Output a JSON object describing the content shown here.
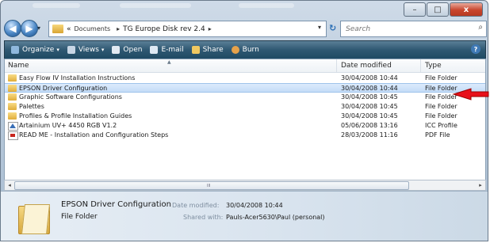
{
  "window": {
    "caption_buttons": {
      "minimize": "–",
      "maximize": "□",
      "close": "x"
    }
  },
  "address_bar": {
    "back_glyph": "◀",
    "forward_glyph": "▶",
    "overflow": "«",
    "crumbs": [
      "Documents",
      "TG Europe Disk rev 2.4"
    ],
    "separator": "▸",
    "dropdown_glyph": "▾",
    "refresh_glyph": "↻"
  },
  "search": {
    "placeholder": "Search",
    "icon": "search-icon"
  },
  "toolbar": {
    "organize": "Organize",
    "views": "Views",
    "open": "Open",
    "email": "E-mail",
    "share": "Share",
    "burn": "Burn",
    "help": "?"
  },
  "columns": {
    "name": "Name",
    "date": "Date modified",
    "type": "Type"
  },
  "files": [
    {
      "name": "Easy Flow IV Installation Instructions",
      "date": "30/04/2008 10:44",
      "type": "File Folder",
      "icon": "folder-icon"
    },
    {
      "name": "EPSON Driver Configuration",
      "date": "30/04/2008 10:44",
      "type": "File Folder",
      "icon": "folder-icon",
      "selected": true
    },
    {
      "name": "Graphic Software Configurations",
      "date": "30/04/2008 10:45",
      "type": "File Folder",
      "icon": "folder-icon"
    },
    {
      "name": "Palettes",
      "date": "30/04/2008 10:45",
      "type": "File Folder",
      "icon": "folder-icon"
    },
    {
      "name": "Profiles & Profile Installation Guides",
      "date": "30/04/2008 10:45",
      "type": "File Folder",
      "icon": "folder-icon"
    },
    {
      "name": "Artainium UV+ 4450 RGB V1.2",
      "date": "05/06/2008 13:16",
      "type": "ICC Profile",
      "icon": "icc-profile-icon"
    },
    {
      "name": "READ ME - Installation and Configuration Steps",
      "date": "28/03/2008 11:16",
      "type": "PDF File",
      "icon": "pdf-icon"
    }
  ],
  "details_pane": {
    "name": "EPSON Driver Configuration",
    "type": "File Folder",
    "date_label": "Date modified:",
    "date_value": "30/04/2008 10:44",
    "shared_label": "Shared with:",
    "shared_value": "Pauls-Acer5630\\Paul (personal)"
  },
  "colors": {
    "accent_arrow": "#e8101a",
    "selection": "#c4dcf7",
    "toolbar": "#2f5872"
  }
}
